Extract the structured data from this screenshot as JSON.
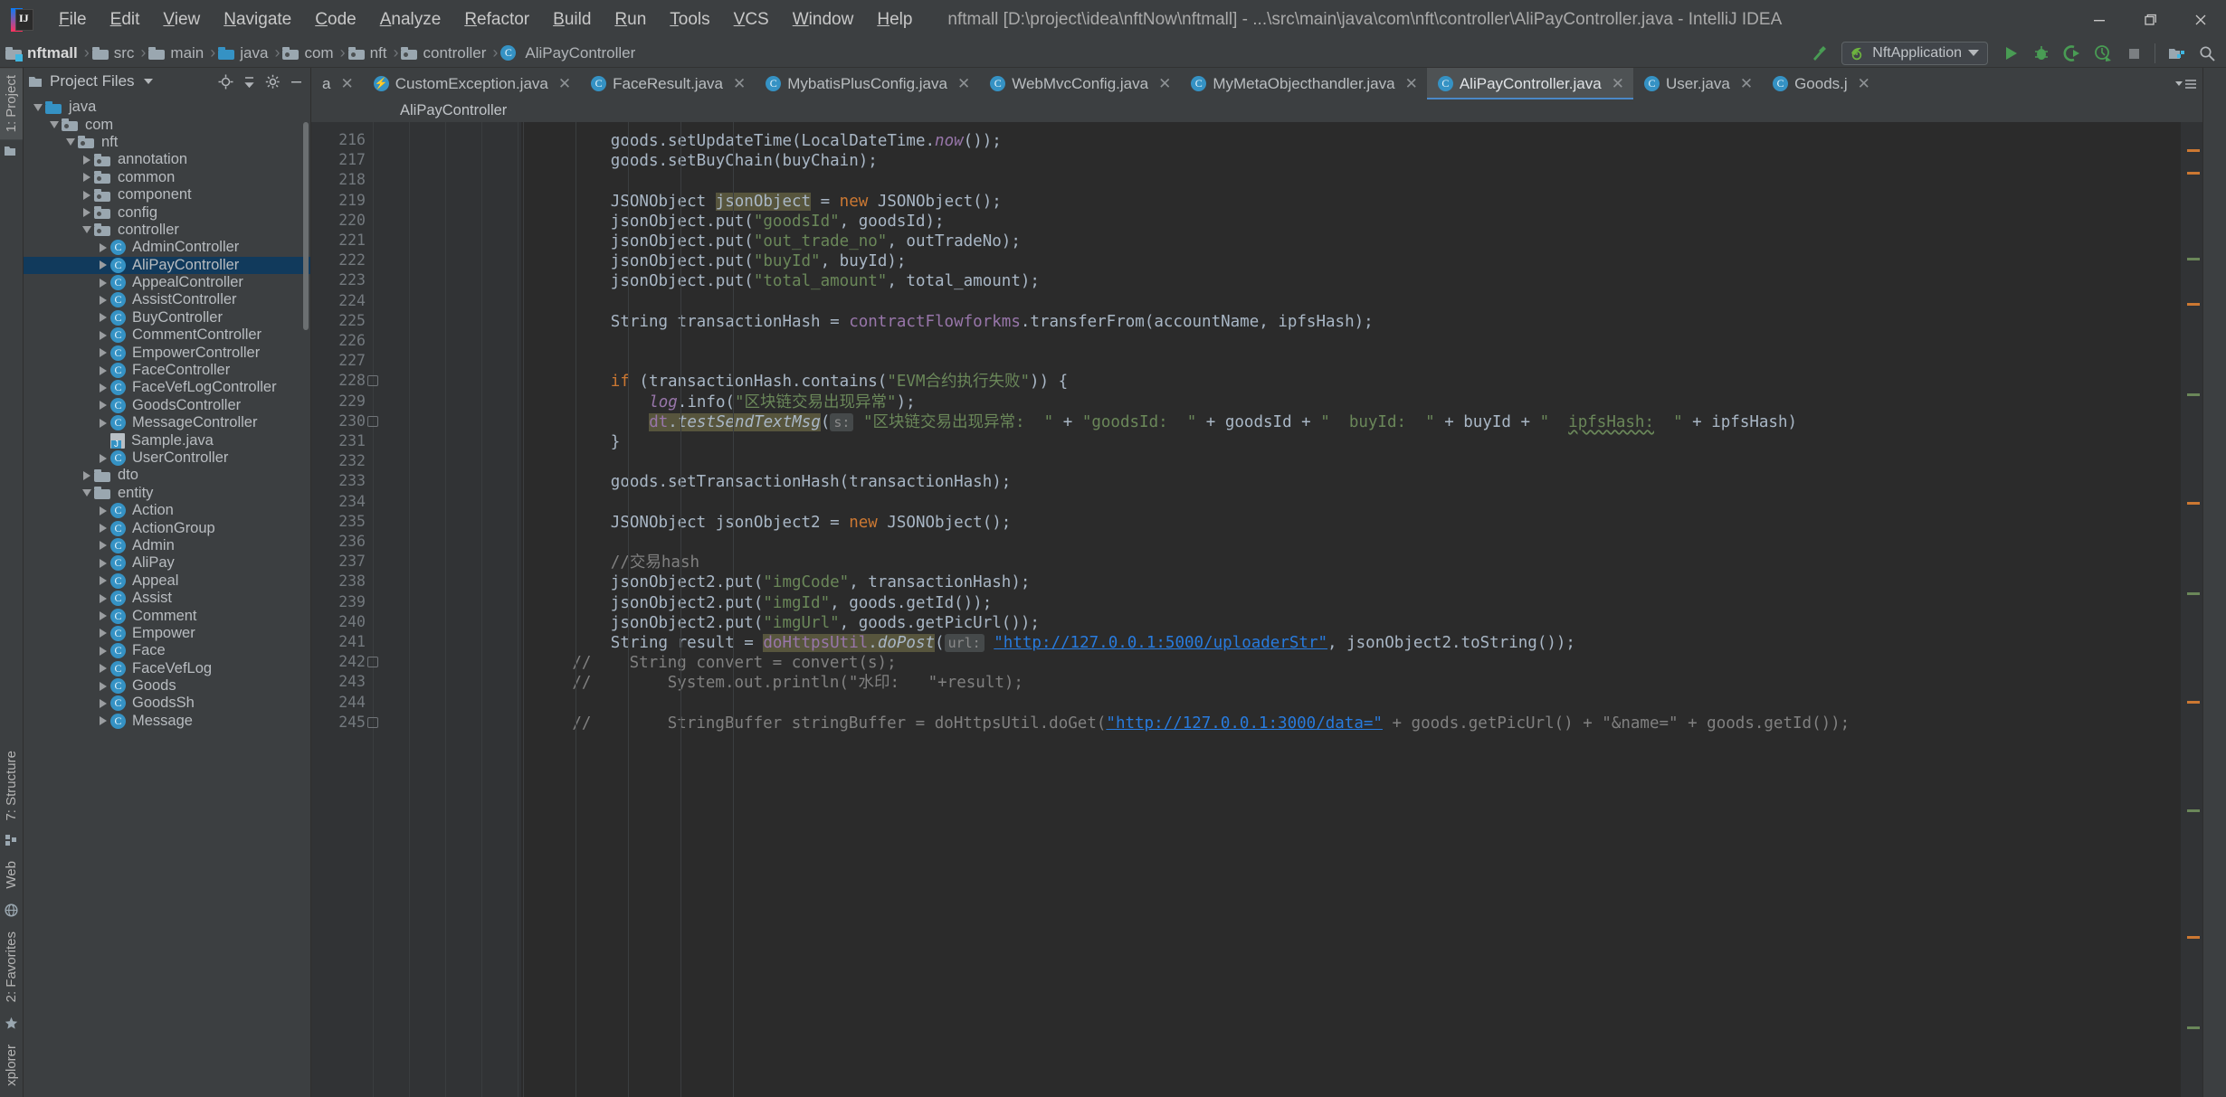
{
  "window": {
    "title": "nftmall [D:\\project\\idea\\nftNow\\nftmall] - ...\\src\\main\\java\\com\\nft\\controller\\AliPayController.java - IntelliJ IDEA",
    "minimize_label": "—",
    "maximize_label": "❐",
    "close_label": "✕"
  },
  "menubar": [
    {
      "label": "File"
    },
    {
      "label": "Edit"
    },
    {
      "label": "View"
    },
    {
      "label": "Navigate"
    },
    {
      "label": "Code"
    },
    {
      "label": "Analyze"
    },
    {
      "label": "Refactor"
    },
    {
      "label": "Build"
    },
    {
      "label": "Run"
    },
    {
      "label": "Tools"
    },
    {
      "label": "VCS"
    },
    {
      "label": "Window"
    },
    {
      "label": "Help"
    }
  ],
  "navbar": {
    "crumbs": [
      {
        "label": "nftmall",
        "icon": "module-folder-icon"
      },
      {
        "label": "src",
        "icon": "folder-icon"
      },
      {
        "label": "main",
        "icon": "folder-icon"
      },
      {
        "label": "java",
        "icon": "source-folder-icon"
      },
      {
        "label": "com",
        "icon": "package-icon"
      },
      {
        "label": "nft",
        "icon": "package-icon"
      },
      {
        "label": "controller",
        "icon": "package-icon"
      },
      {
        "label": "AliPayController",
        "icon": "class-icon"
      }
    ],
    "separator": "›",
    "run_config": "NftApplication",
    "buttons": [
      {
        "name": "build-hammer-icon"
      },
      {
        "name": "run-icon"
      },
      {
        "name": "debug-icon"
      },
      {
        "name": "run-coverage-icon"
      },
      {
        "name": "profiler-icon"
      },
      {
        "name": "stop-icon"
      },
      {
        "name": "project-structure-icon"
      }
    ]
  },
  "project_panel": {
    "title": "Project Files",
    "tool_icons": [
      "locate-icon",
      "collapse-all-icon",
      "settings-gear-icon",
      "hide-icon"
    ],
    "tree": [
      {
        "label": "java",
        "depth": 2,
        "state": "open",
        "icon": "source-folder-icon"
      },
      {
        "label": "com",
        "depth": 3,
        "state": "open",
        "icon": "package-icon"
      },
      {
        "label": "nft",
        "depth": 4,
        "state": "open",
        "icon": "package-icon"
      },
      {
        "label": "annotation",
        "depth": 5,
        "state": "closed",
        "icon": "package-icon"
      },
      {
        "label": "common",
        "depth": 5,
        "state": "closed",
        "icon": "package-icon"
      },
      {
        "label": "component",
        "depth": 5,
        "state": "closed",
        "icon": "package-icon"
      },
      {
        "label": "config",
        "depth": 5,
        "state": "closed",
        "icon": "package-icon"
      },
      {
        "label": "controller",
        "depth": 5,
        "state": "open",
        "icon": "package-icon"
      },
      {
        "label": "AdminController",
        "depth": 6,
        "state": "closed",
        "icon": "class-icon"
      },
      {
        "label": "AliPayController",
        "depth": 6,
        "state": "closed",
        "icon": "class-icon",
        "selected": true
      },
      {
        "label": "AppealController",
        "depth": 6,
        "state": "closed",
        "icon": "class-icon"
      },
      {
        "label": "AssistController",
        "depth": 6,
        "state": "closed",
        "icon": "class-icon"
      },
      {
        "label": "BuyController",
        "depth": 6,
        "state": "closed",
        "icon": "class-icon"
      },
      {
        "label": "CommentController",
        "depth": 6,
        "state": "closed",
        "icon": "class-icon"
      },
      {
        "label": "EmpowerController",
        "depth": 6,
        "state": "closed",
        "icon": "class-icon"
      },
      {
        "label": "FaceController",
        "depth": 6,
        "state": "closed",
        "icon": "class-icon"
      },
      {
        "label": "FaceVefLogController",
        "depth": 6,
        "state": "closed",
        "icon": "class-icon"
      },
      {
        "label": "GoodsController",
        "depth": 6,
        "state": "closed",
        "icon": "class-icon"
      },
      {
        "label": "MessageController",
        "depth": 6,
        "state": "closed",
        "icon": "class-icon"
      },
      {
        "label": "Sample.java",
        "depth": 6,
        "state": "leaf",
        "icon": "java-file-icon"
      },
      {
        "label": "UserController",
        "depth": 6,
        "state": "closed",
        "icon": "class-icon"
      },
      {
        "label": "dto",
        "depth": 5,
        "state": "closed",
        "icon": "folder-icon"
      },
      {
        "label": "entity",
        "depth": 5,
        "state": "open",
        "icon": "folder-icon"
      },
      {
        "label": "Action",
        "depth": 6,
        "state": "closed",
        "icon": "class-icon"
      },
      {
        "label": "ActionGroup",
        "depth": 6,
        "state": "closed",
        "icon": "class-icon"
      },
      {
        "label": "Admin",
        "depth": 6,
        "state": "closed",
        "icon": "class-icon"
      },
      {
        "label": "AliPay",
        "depth": 6,
        "state": "closed",
        "icon": "class-icon"
      },
      {
        "label": "Appeal",
        "depth": 6,
        "state": "closed",
        "icon": "class-icon"
      },
      {
        "label": "Assist",
        "depth": 6,
        "state": "closed",
        "icon": "class-icon"
      },
      {
        "label": "Comment",
        "depth": 6,
        "state": "closed",
        "icon": "class-icon"
      },
      {
        "label": "Empower",
        "depth": 6,
        "state": "closed",
        "icon": "class-icon"
      },
      {
        "label": "Face",
        "depth": 6,
        "state": "closed",
        "icon": "class-icon"
      },
      {
        "label": "FaceVefLog",
        "depth": 6,
        "state": "closed",
        "icon": "class-icon"
      },
      {
        "label": "Goods",
        "depth": 6,
        "state": "closed",
        "icon": "class-icon"
      },
      {
        "label": "GoodsSh",
        "depth": 6,
        "state": "closed",
        "icon": "class-icon"
      },
      {
        "label": "Message",
        "depth": 6,
        "state": "closed",
        "icon": "class-icon"
      }
    ]
  },
  "left_tool_tabs": [
    {
      "label": "1: Project",
      "selected": true
    },
    {
      "label": "7: Structure",
      "selected": false
    },
    {
      "label": "Web",
      "selected": false
    },
    {
      "label": "2: Favorites",
      "selected": false
    },
    {
      "label": "xplorer",
      "selected": false
    }
  ],
  "editor_tabs": [
    {
      "label": "a",
      "icon": "class-icon",
      "active": false,
      "truncated": true
    },
    {
      "label": "CustomException.java",
      "icon": "exception-class-icon",
      "active": false
    },
    {
      "label": "FaceResult.java",
      "icon": "class-icon",
      "active": false
    },
    {
      "label": "MybatisPlusConfig.java",
      "icon": "class-icon",
      "active": false
    },
    {
      "label": "WebMvcConfig.java",
      "icon": "class-icon",
      "active": false
    },
    {
      "label": "MyMetaObjecthandler.java",
      "icon": "class-icon",
      "active": false
    },
    {
      "label": "AliPayController.java",
      "icon": "class-icon",
      "active": true
    },
    {
      "label": "User.java",
      "icon": "class-icon",
      "active": false
    },
    {
      "label": "Goods.j",
      "icon": "class-icon",
      "active": false,
      "truncated": true
    }
  ],
  "editor_breadcrumb": "AliPayController",
  "code": {
    "first_line_number": 216,
    "lines": [
      {
        "n": 216,
        "indent": 8,
        "tokens": [
          {
            "t": "goods",
            "c": "id"
          },
          {
            "t": ".setUpdateTime(",
            "c": "op"
          },
          {
            "t": "LocalDateTime",
            "c": "id"
          },
          {
            "t": ".",
            "c": "op"
          },
          {
            "t": "now",
            "c": "stat"
          },
          {
            "t": "());",
            "c": "op"
          }
        ]
      },
      {
        "n": 217,
        "indent": 8,
        "tokens": [
          {
            "t": "goods",
            "c": "id"
          },
          {
            "t": ".setBuyChain(buyChain);",
            "c": "op"
          }
        ]
      },
      {
        "n": 218,
        "indent": 0,
        "tokens": []
      },
      {
        "n": 219,
        "indent": 8,
        "tokens": [
          {
            "t": "JSONObject ",
            "c": "id"
          },
          {
            "t": "jsonObject",
            "c": "id hl"
          },
          {
            "t": " = ",
            "c": "op"
          },
          {
            "t": "new ",
            "c": "kw"
          },
          {
            "t": "JSONObject();",
            "c": "id"
          }
        ]
      },
      {
        "n": 220,
        "indent": 8,
        "tokens": [
          {
            "t": "jsonObject.put(",
            "c": "id"
          },
          {
            "t": "\"goodsId\"",
            "c": "str"
          },
          {
            "t": ", goodsId);",
            "c": "op"
          }
        ]
      },
      {
        "n": 221,
        "indent": 8,
        "tokens": [
          {
            "t": "jsonObject.put(",
            "c": "id"
          },
          {
            "t": "\"out_trade_no\"",
            "c": "str"
          },
          {
            "t": ", outTradeNo);",
            "c": "op"
          }
        ]
      },
      {
        "n": 222,
        "indent": 8,
        "tokens": [
          {
            "t": "jsonObject.put(",
            "c": "id"
          },
          {
            "t": "\"buyId\"",
            "c": "str"
          },
          {
            "t": ", buyId);",
            "c": "op"
          }
        ]
      },
      {
        "n": 223,
        "indent": 8,
        "tokens": [
          {
            "t": "jsonObject.put(",
            "c": "id"
          },
          {
            "t": "\"total_amount\"",
            "c": "str"
          },
          {
            "t": ", total_amount);",
            "c": "op"
          }
        ]
      },
      {
        "n": 224,
        "indent": 0,
        "tokens": []
      },
      {
        "n": 225,
        "indent": 8,
        "tokens": [
          {
            "t": "String transactionHash = ",
            "c": "id"
          },
          {
            "t": "contractFlowforkms",
            "c": "fld2"
          },
          {
            "t": ".transferFrom(accountName, ipfsHash);",
            "c": "op"
          }
        ]
      },
      {
        "n": 226,
        "indent": 0,
        "tokens": []
      },
      {
        "n": 227,
        "indent": 0,
        "tokens": []
      },
      {
        "n": 228,
        "indent": 8,
        "tokens": [
          {
            "t": "if ",
            "c": "kw"
          },
          {
            "t": "(transactionHash.contains(",
            "c": "op"
          },
          {
            "t": "\"EVM合约执行失败\"",
            "c": "str"
          },
          {
            "t": ")) {",
            "c": "op"
          }
        ]
      },
      {
        "n": 229,
        "indent": 12,
        "tokens": [
          {
            "t": "log",
            "c": "fld2 ital"
          },
          {
            "t": ".info(",
            "c": "op"
          },
          {
            "t": "\"区块链交易出现异常\"",
            "c": "str"
          },
          {
            "t": ");",
            "c": "op"
          }
        ]
      },
      {
        "n": 230,
        "indent": 12,
        "tokens": [
          {
            "t": "dt",
            "c": "fld2 hl"
          },
          {
            "t": ".",
            "c": "op hl"
          },
          {
            "t": "testSendTextMsg",
            "c": "op hl ital"
          },
          {
            "t": "(",
            "c": "op"
          },
          {
            "t": " s: ",
            "c": "hintspan"
          },
          {
            "t": "\"区块链交易出现异常:  \"",
            "c": "str"
          },
          {
            "t": " + ",
            "c": "op"
          },
          {
            "t": "\"goodsId:  \"",
            "c": "str"
          },
          {
            "t": " + goodsId + ",
            "c": "op"
          },
          {
            "t": "\"  buyId:  \"",
            "c": "str"
          },
          {
            "t": " + buyId + ",
            "c": "op"
          },
          {
            "t": "\"  ",
            "c": "str"
          },
          {
            "t": "ipfsHash:",
            "c": "str typo"
          },
          {
            "t": "  \"",
            "c": "str"
          },
          {
            "t": " + ipfsHash)",
            "c": "op"
          }
        ]
      },
      {
        "n": 231,
        "indent": 8,
        "tokens": [
          {
            "t": "}",
            "c": "op"
          }
        ]
      },
      {
        "n": 232,
        "indent": 0,
        "tokens": []
      },
      {
        "n": 233,
        "indent": 8,
        "tokens": [
          {
            "t": "goods",
            "c": "id"
          },
          {
            "t": ".setTransactionHash(transactionHash);",
            "c": "op"
          }
        ]
      },
      {
        "n": 234,
        "indent": 0,
        "tokens": []
      },
      {
        "n": 235,
        "indent": 8,
        "tokens": [
          {
            "t": "JSONObject jsonObject2 = ",
            "c": "id"
          },
          {
            "t": "new ",
            "c": "kw"
          },
          {
            "t": "JSONObject();",
            "c": "id"
          }
        ]
      },
      {
        "n": 236,
        "indent": 0,
        "tokens": []
      },
      {
        "n": 237,
        "indent": 8,
        "tokens": [
          {
            "t": "//交易hash",
            "c": "cmt"
          }
        ]
      },
      {
        "n": 238,
        "indent": 8,
        "tokens": [
          {
            "t": "jsonObject2.put(",
            "c": "id"
          },
          {
            "t": "\"imgCode\"",
            "c": "str"
          },
          {
            "t": ", transactionHash);",
            "c": "op"
          }
        ]
      },
      {
        "n": 239,
        "indent": 8,
        "tokens": [
          {
            "t": "jsonObject2.put(",
            "c": "id"
          },
          {
            "t": "\"imgId\"",
            "c": "str"
          },
          {
            "t": ", goods.getId());",
            "c": "op"
          }
        ]
      },
      {
        "n": 240,
        "indent": 8,
        "tokens": [
          {
            "t": "jsonObject2.put(",
            "c": "id"
          },
          {
            "t": "\"imgUrl\"",
            "c": "str"
          },
          {
            "t": ", goods.getPicUrl());",
            "c": "op"
          }
        ]
      },
      {
        "n": 241,
        "indent": 8,
        "tokens": [
          {
            "t": "String result = ",
            "c": "id"
          },
          {
            "t": "doHttpsUtil",
            "c": "fld2 hl"
          },
          {
            "t": ".",
            "c": "op hl"
          },
          {
            "t": "doPost",
            "c": "op hl ital"
          },
          {
            "t": "(",
            "c": "op"
          },
          {
            "t": " url: ",
            "c": "hintspan"
          },
          {
            "t": "\"http://127.0.0.1:5000/uploaderStr\"",
            "c": "strlink"
          },
          {
            "t": ", jsonObject2.toString());",
            "c": "op"
          }
        ]
      },
      {
        "n": 242,
        "indent": 4,
        "tokens": [
          {
            "t": "//    String convert = convert(s);",
            "c": "cmt"
          }
        ]
      },
      {
        "n": 243,
        "indent": 4,
        "tokens": [
          {
            "t": "//        System.out.println(\"水印:   \"+result);",
            "c": "cmt"
          }
        ]
      },
      {
        "n": 244,
        "indent": 0,
        "tokens": []
      },
      {
        "n": 245,
        "indent": 4,
        "tokens": [
          {
            "t": "//        StringBuffer stringBuffer = doHttpsUtil.doGet(",
            "c": "cmt"
          },
          {
            "t": "\"http://127.0.0.1:3000/data=\"",
            "c": "cmtlink"
          },
          {
            "t": " + goods.getPicUrl() + \"&name=\" + goods.getId());",
            "c": "cmt"
          }
        ]
      }
    ],
    "folds": [
      228,
      230,
      242,
      245
    ]
  }
}
